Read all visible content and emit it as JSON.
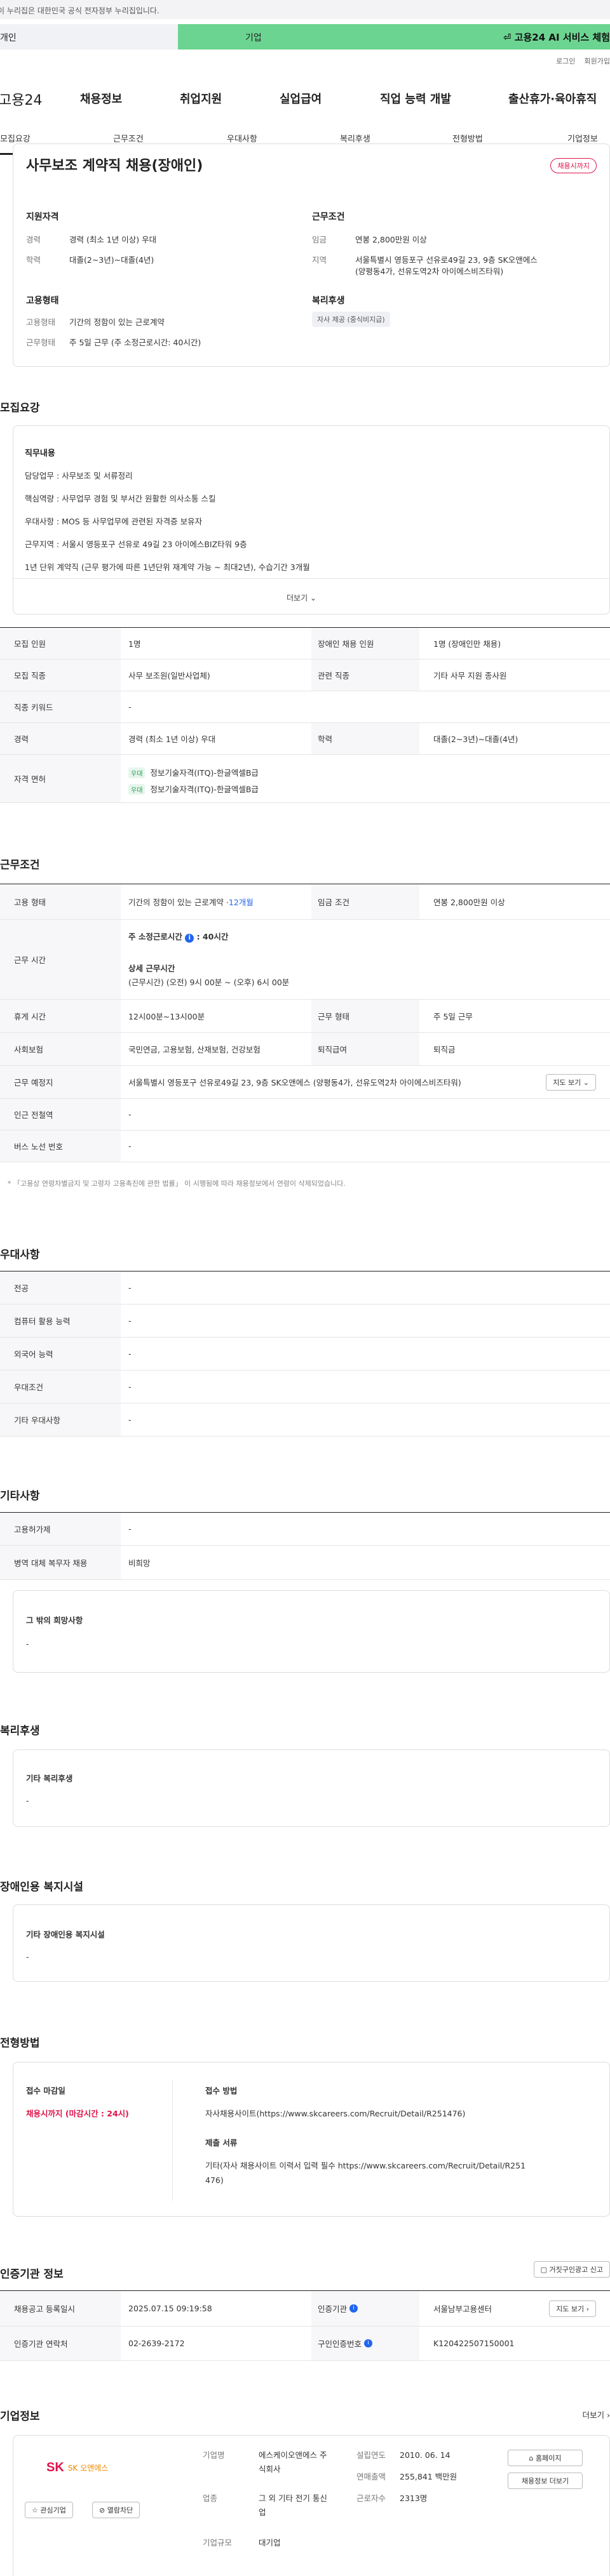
{
  "gov_banner": "이 누리집은 대한민국 공식 전자정부 누리집입니다.",
  "top_tabs": {
    "left": "개인",
    "mid": "기업",
    "ai_service": "고용24 AI 서비스 체험"
  },
  "util_links": [
    "로그인",
    "회원가입"
  ],
  "gnb": {
    "logo": "고용24",
    "menu": [
      "채용정보",
      "취업지원",
      "실업급여",
      "직업 능력 개발",
      "출산휴가·육아휴직"
    ]
  },
  "subnav": [
    "모집요강",
    "근무조건",
    "우대사항",
    "복리후생",
    "전형방법",
    "기업정보"
  ],
  "summary": {
    "title": "사무보조 계약직 채용(장애인)",
    "dday": "채용시까지",
    "qual": {
      "heading": "지원자격",
      "rows": [
        {
          "k": "경력",
          "v": "경력 (최소 1년 이상) 우대"
        },
        {
          "k": "학력",
          "v": "대졸(2~3년)~대졸(4년)"
        }
      ]
    },
    "cond": {
      "heading": "근무조건",
      "rows": [
        {
          "k": "임금",
          "v": "연봉 2,800만원 이상"
        },
        {
          "k": "지역",
          "v": "서울특별시 영등포구 선유로49길 23, 9층 SK오앤에스",
          "v2": "(양평동4가, 선유도역2차 아이에스비즈타워)"
        }
      ]
    },
    "emp": {
      "heading": "고용형태",
      "rows": [
        {
          "k": "고용형태",
          "v": "기간의 정함이 있는 근로계약"
        },
        {
          "k": "근무형태",
          "v": "주 5일 근무 (주 소정근로시간: 40시간)"
        }
      ]
    },
    "welfare": {
      "heading": "복리후생",
      "tag": "자사 제공 (중식비지급)"
    }
  },
  "recruit": {
    "heading": "모집요강",
    "duty_heading": "직무내용",
    "duties": [
      "담당업무 : 사무보조 및 서류정리",
      "핵심역량 : 사무업무 경험 및 부서간 원활한 의사소통 스킬",
      "우대사항 : MOS 등 사무업무에 관련된 자격증 보유자",
      "근무지역 : 서울시 영등포구 선유로 49길 23 아이에스BIZ타워 9층",
      "1년 단위 계약직 (근무 평가에 따른 1년단위 재계약 가능 ~ 최대2년), 수습기간 3개월"
    ],
    "more": "더보기",
    "table": [
      {
        "th": "모집 인원",
        "td": "1명",
        "th2": "장애인 채용 인원",
        "td2": "1명 (장애인만 채용)"
      },
      {
        "th": "모집 직종",
        "td": "사무 보조원(일반사업체)",
        "th2": "관련 직종",
        "td2": "기타 사무 지원 종사원"
      },
      {
        "th": "직종 키워드",
        "td": "-"
      },
      {
        "th": "경력",
        "td": "경력 (최소 1년 이상) 우대",
        "th2": "학력",
        "td2": "대졸(2~3년)~대졸(4년)"
      }
    ],
    "license_th": "자격 면허",
    "licenses": [
      {
        "badge": "우대",
        "name": "정보기술자격(ITQ)-한글엑셀B급"
      },
      {
        "badge": "우대",
        "name": "정보기술자격(ITQ)-한글엑셀B급"
      }
    ]
  },
  "work": {
    "heading": "근무조건",
    "emp_th": "고용 형태",
    "emp_td": "기간의 정함이 있는 근로계약 · ",
    "emp_td_link": "12개월",
    "wage_th": "임금 조건",
    "wage_td": "연봉 2,800만원 이상",
    "hours_th": "근무 시간",
    "hours_label": "주 소정근로시간",
    "hours_value": "40시간",
    "hours_detail_label": "상세 근무시간",
    "hours_detail": "(근무시간) (오전) 9시 00분 ~ (오후) 6시 00분",
    "rest_th": "휴게 시간",
    "rest_td": "12시00분~13시00분",
    "form_th": "근무 형태",
    "form_td": "주 5일 근무",
    "ins_th": "사회보험",
    "ins_td": "국민연금, 고용보험, 산재보험, 건강보험",
    "sev_th": "퇴직급여",
    "sev_td": "퇴직금",
    "place_th": "근무 예정지",
    "place_td": "서울특별시 영등포구 선유로49길 23, 9층 SK오앤에스 (양평동4가, 선유도역2차 아이에스비즈타워)",
    "map_btn": "지도 보기",
    "subway_th": "인근 전철역",
    "subway_td": "-",
    "bus_th": "버스 노선 번호",
    "bus_td": "-",
    "note": "* 「고용상 연령차별금지 및 고령자 고용촉진에 관한 법률」 이 시행됨에 따라 채용정보에서 연령이 삭제되었습니다."
  },
  "pref": {
    "heading": "우대사항",
    "rows": [
      {
        "th": "전공",
        "td": "-"
      },
      {
        "th": "컴퓨터 활용 능력",
        "td": "-"
      },
      {
        "th": "외국어 능력",
        "td": "-"
      },
      {
        "th": "우대조건",
        "td": "-"
      },
      {
        "th": "기타 우대사항",
        "td": "-"
      }
    ]
  },
  "etc": {
    "heading": "기타사항",
    "rows": [
      {
        "th": "고용허가제",
        "td": "-"
      },
      {
        "th": "병역 대체 복무자 채용",
        "td": "비희망"
      }
    ],
    "hope_label": "그 밖의 희망사항",
    "hope_value": "-"
  },
  "welfare": {
    "heading": "복리후생",
    "label": "기타 복리후생",
    "value": "-"
  },
  "disabled": {
    "heading": "장애인용 복지시설",
    "label": "기타 장애인용 복지시설",
    "value": "-"
  },
  "process": {
    "heading": "전형방법",
    "deadline_label": "접수 마감일",
    "deadline_value": "채용시까지 (마감시간 : 24시)",
    "method_label": "접수 방법",
    "method_value": "자사채용사이트(https://www.skcareers.com/Recruit/Detail/R251476)",
    "docs_label": "제출 서류",
    "docs_value1": "기타(자사 채용사이트 이력서 입력  필수 https://www.skcareers.com/Recruit/Detail/R251",
    "docs_value2": "476)"
  },
  "cert": {
    "heading": "인증기관 정보",
    "report_btn": "거짓구인광고 신고",
    "rows": [
      {
        "th": "채용공고 등록일시",
        "td": "2025.07.15 09:19:58",
        "th2": "인증기관",
        "td2": "서울남부고용센터",
        "btn": "지도 보기"
      },
      {
        "th": "인증기관 연락처",
        "td": "02-2639-2172",
        "th2": "구인인증번호",
        "td2": "K120422507150001"
      }
    ]
  },
  "company": {
    "heading": "기업정보",
    "more": "더보기",
    "logo_text": "SK 오앤에스",
    "follow_btn": "관심기업",
    "block_btn": "열람차단",
    "info": [
      {
        "k": "기업명",
        "v": "에스케이오앤에스 주식회사"
      },
      {
        "k": "업종",
        "v": "그 외 기타 전기 통신업"
      },
      {
        "k": "기업규모",
        "v": "대기업"
      }
    ],
    "info2": [
      {
        "k": "설립연도",
        "v": "2010. 06. 14"
      },
      {
        "k": "연매출액",
        "v": "255,841 백만원"
      },
      {
        "k": "근로자수",
        "v": "2313명"
      }
    ],
    "homepage_btn": "홈페이지",
    "jobs_btn": "채용정보 더보기"
  },
  "colors": {
    "green": "#6cd491",
    "red": "#e0144a",
    "blue": "#2165f0"
  }
}
